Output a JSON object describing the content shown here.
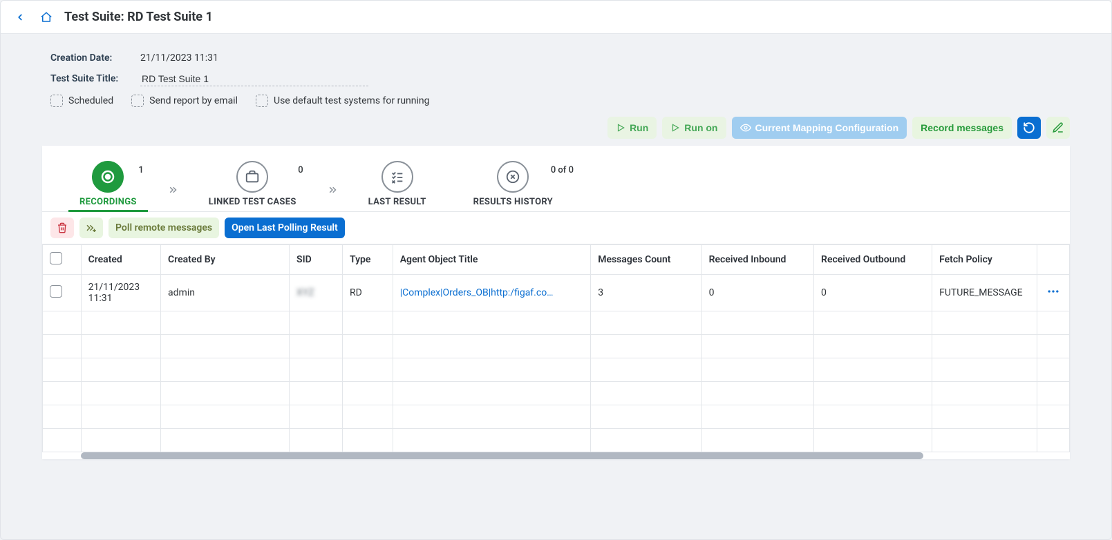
{
  "header": {
    "title": "Test Suite: RD Test Suite 1"
  },
  "meta": {
    "creation_label": "Creation Date:",
    "creation_value": "21/11/2023 11:31",
    "title_label": "Test Suite Title:",
    "title_value": "RD Test Suite 1",
    "chk_scheduled": "Scheduled",
    "chk_email": "Send report by email",
    "chk_default_systems": "Use default test systems for running"
  },
  "toolbar": {
    "run": "Run",
    "run_on": "Run on",
    "mapping": "Current Mapping Configuration",
    "record": "Record messages"
  },
  "tabs": {
    "recordings": {
      "label": "RECORDINGS",
      "count": "1"
    },
    "linked": {
      "label": "LINKED TEST CASES",
      "count": "0"
    },
    "last": {
      "label": "LAST RESULT"
    },
    "history": {
      "label": "RESULTS HISTORY",
      "count": "0 of 0"
    }
  },
  "subbar": {
    "poll": "Poll remote messages",
    "open_last": "Open Last Polling Result"
  },
  "table": {
    "headers": {
      "created": "Created",
      "created_by": "Created By",
      "sid": "SID",
      "type": "Type",
      "agent": "Agent Object Title",
      "msgs": "Messages Count",
      "inbound": "Received Inbound",
      "outbound": "Received Outbound",
      "fetch": "Fetch Policy"
    },
    "rows": [
      {
        "created": "21/11/2023 11:31",
        "created_by": "admin",
        "sid": "XYZ",
        "type": "RD",
        "agent": "|Complex|Orders_OB|http:/figaf.co…",
        "msgs": "3",
        "inbound": "0",
        "outbound": "0",
        "fetch": "FUTURE_MESSAGE"
      }
    ]
  }
}
